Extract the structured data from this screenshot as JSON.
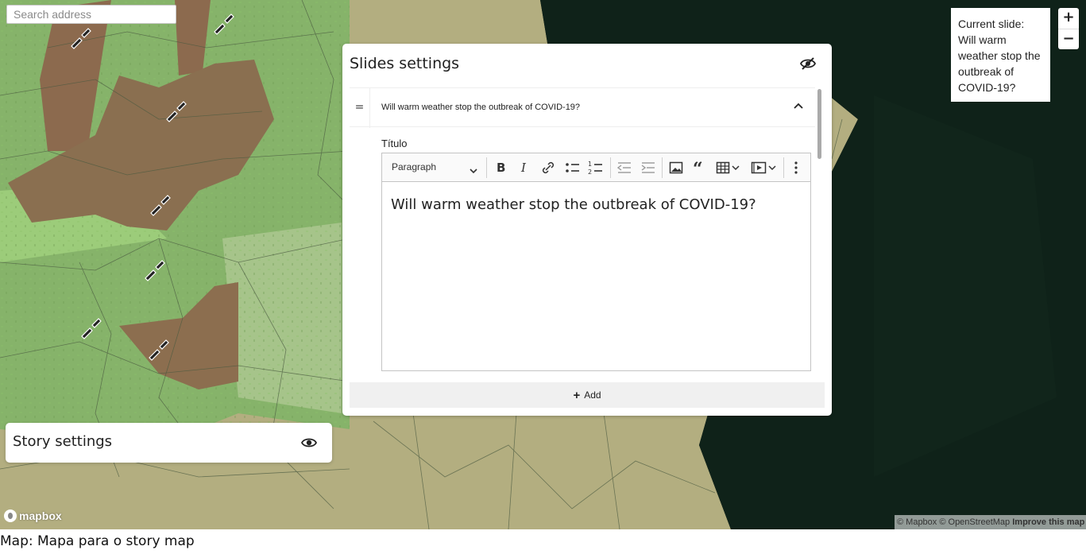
{
  "search": {
    "placeholder": "Search address"
  },
  "zoom": {
    "in_label": "+",
    "out_label": "−"
  },
  "current_slide": {
    "text": "Current slide: Will warm weather stop the outbreak of COVID-19?"
  },
  "slides_panel": {
    "title": "Slides settings",
    "hide_icon": "eye-slash-icon",
    "slide": {
      "drag_label": "=",
      "header_title": "Will warm weather stop the outbreak of COVID-19?",
      "field_label": "Título",
      "editor": {
        "paragraph_select": "Paragraph",
        "toolbar_icons": [
          "bold-icon",
          "italic-icon",
          "link-icon",
          "bulleted-list-icon",
          "numbered-list-icon",
          "outdent-icon",
          "indent-icon",
          "image-icon",
          "blockquote-icon",
          "table-icon",
          "media-icon",
          "more-icon"
        ],
        "content": "Will warm weather stop the outbreak of COVID-19?"
      }
    },
    "add_label": "Add"
  },
  "story_panel": {
    "title": "Story settings",
    "eye_icon": "eye-icon"
  },
  "map": {
    "logo_text": "mapbox",
    "attribution_1": "© Mapbox © OpenStreetMap",
    "attribution_2": "Improve this map"
  },
  "caption": "Map: Mapa para o story map"
}
